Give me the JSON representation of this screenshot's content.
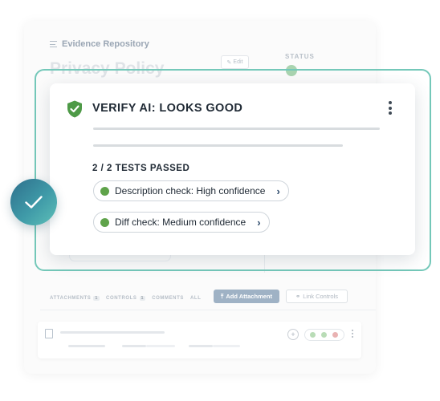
{
  "background_app": {
    "breadcrumb": "Evidence Repository",
    "page_title": "Privacy Policy",
    "edit_label": "Edit",
    "status_label": "STATUS",
    "tabs": [
      {
        "label": "ATTACHMENTS",
        "count": "1"
      },
      {
        "label": "CONTROLS",
        "count": "1"
      },
      {
        "label": "COMMENTS",
        "count": ""
      },
      {
        "label": "ALL",
        "count": ""
      }
    ],
    "add_attachment_label": "Add Attachment",
    "link_controls_label": "Link Controls"
  },
  "verify_card": {
    "title": "VERIFY AI: LOOKS GOOD",
    "tests_summary": "2 / 2 TESTS PASSED",
    "checks": [
      {
        "label": "Description check: High confidence",
        "status_color": "#5fa34a"
      },
      {
        "label": "Diff check: Medium confidence",
        "status_color": "#5fa34a"
      }
    ]
  },
  "colors": {
    "accent_teal": "#74c8b9",
    "shield_green": "#4e9a47",
    "status_green": "#5fa34a",
    "bubble_gradient": [
      "#2e6f8c",
      "#5ec0b8"
    ]
  },
  "icons": [
    "list-icon",
    "shield-check-icon",
    "kebab-icon",
    "chevron-right-icon",
    "checkmark-icon",
    "document-icon",
    "link-icon",
    "upload-icon",
    "pencil-icon"
  ]
}
